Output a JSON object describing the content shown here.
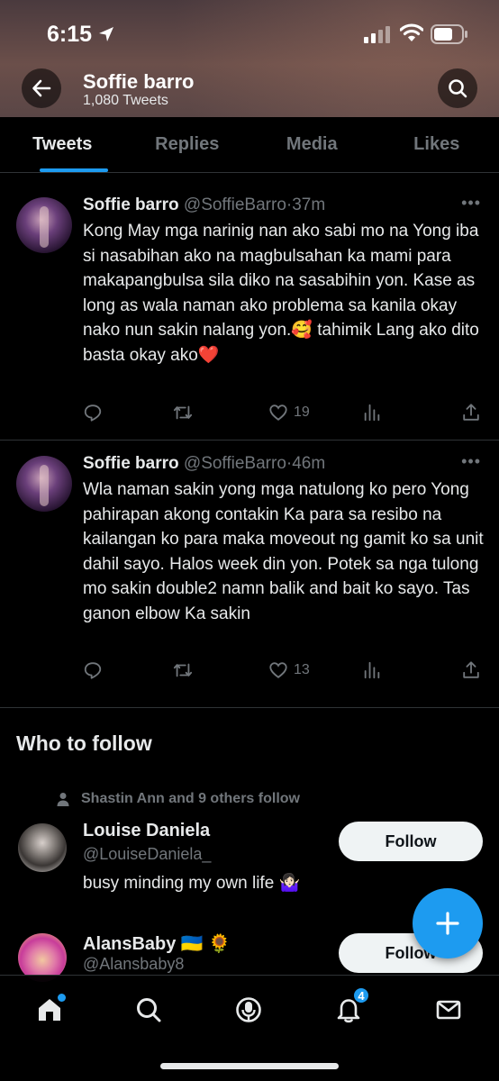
{
  "status_bar": {
    "time": "6:15"
  },
  "header": {
    "name": "Soffie barro",
    "tweet_count": "1,080 Tweets"
  },
  "tabs": [
    {
      "label": "Tweets",
      "active": true
    },
    {
      "label": "Replies",
      "active": false
    },
    {
      "label": "Media",
      "active": false
    },
    {
      "label": "Likes",
      "active": false
    }
  ],
  "tweets": [
    {
      "name": "Soffie barro",
      "handle": "@SoffieBarro",
      "time": "·37m",
      "text": "Kong May mga narinig nan ako sabi mo na Yong iba si nasabihan ako na magbulsahan ka mami para makapangbulsa sila diko na sasabihin yon. Kase as long as wala naman ako problema sa kanila okay nako nun sakin nalang yon.🥰 tahimik Lang ako dito basta okay ako❤️",
      "likes": "19"
    },
    {
      "name": "Soffie barro",
      "handle": "@SoffieBarro",
      "time": "·46m",
      "text": "Wla naman sakin yong mga natulong ko pero Yong pahirapan akong contakin Ka para sa resibo na kailangan ko para maka moveout ng gamit ko sa unit dahil sayo. Halos week din yon. Potek sa nga tulong mo sakin double2 namn balik and bait ko sayo. Tas ganon elbow Ka sakin",
      "likes": "13"
    }
  ],
  "who_to_follow": {
    "title": "Who to follow",
    "suggestions": [
      {
        "context": "Shastin Ann and 9 others follow",
        "name": "Louise Daniela",
        "handle": "@LouiseDaniela_",
        "bio": "busy minding my own life 🤷🏻‍♀️",
        "button": "Follow"
      },
      {
        "name": "AlansBaby 🇺🇦 🌻",
        "handle": "@Alansbaby8",
        "button": "Follow"
      }
    ]
  },
  "bottom_nav": {
    "notifications_badge": "4"
  },
  "colors": {
    "accent": "#1d9bf0",
    "background": "#000000",
    "muted": "#71767b"
  }
}
